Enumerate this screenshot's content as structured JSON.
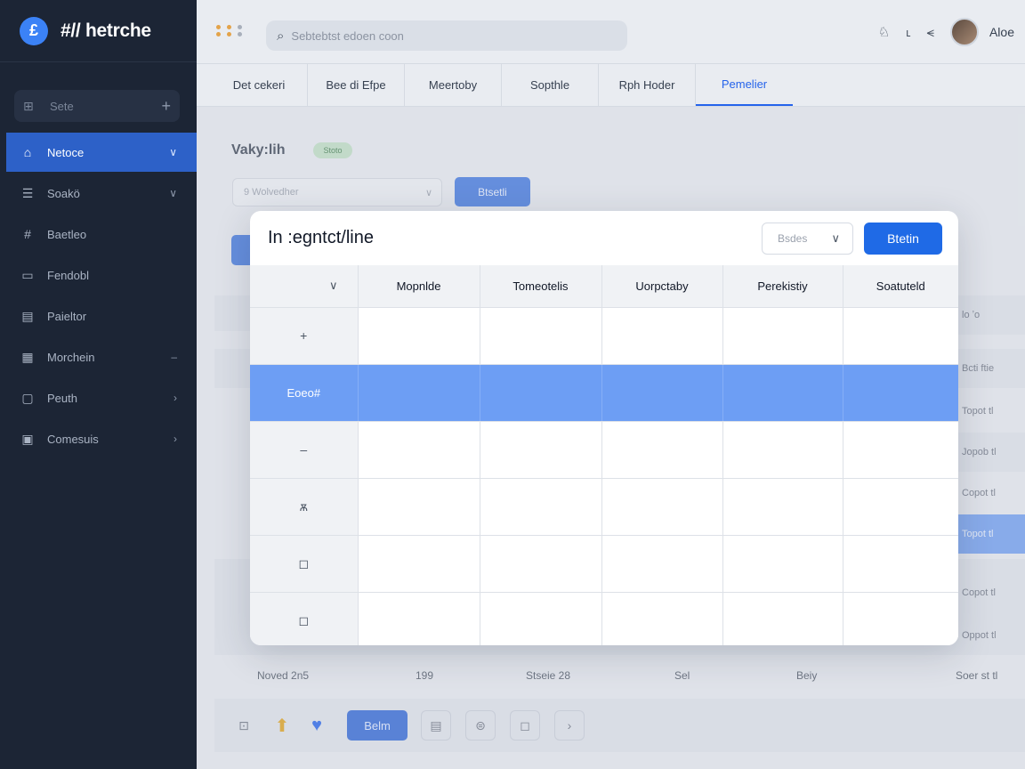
{
  "brand": {
    "logo_glyph": "£",
    "name": "#// hetrche"
  },
  "sidebar": {
    "search": {
      "label": "Sete"
    },
    "items": [
      {
        "label": "Netoce",
        "icon": "store-icon",
        "glyph": "⌂",
        "chevron": "∨",
        "active": true
      },
      {
        "label": "Soakö",
        "icon": "list-icon",
        "glyph": "☰",
        "chevron": "∨"
      },
      {
        "label": "Baetleo",
        "icon": "hashtag-icon",
        "glyph": "#",
        "chevron": ""
      },
      {
        "label": "Fendobl",
        "icon": "tablet-icon",
        "glyph": "▭",
        "chevron": ""
      },
      {
        "label": "Paieltor",
        "icon": "calendar-icon",
        "glyph": "▤",
        "chevron": ""
      },
      {
        "label": "Morchein",
        "icon": "grid-icon",
        "glyph": "▦",
        "chevron": "–"
      },
      {
        "label": "Peuth",
        "icon": "folder-icon",
        "glyph": "▢",
        "chevron": "›"
      },
      {
        "label": "Comesuis",
        "icon": "image-icon",
        "glyph": "▣",
        "chevron": "›"
      }
    ]
  },
  "topbar": {
    "search_text": "Sebtebtst edoen coon",
    "user_name": "Aloe"
  },
  "tabs": [
    {
      "label": "Det cekeri",
      "active": false
    },
    {
      "label": "Bee di Efpe",
      "active": false
    },
    {
      "label": "Meertoby",
      "active": false
    },
    {
      "label": "Sopthle",
      "active": false
    },
    {
      "label": "Rph Hoder",
      "active": false
    },
    {
      "label": "Pemelier",
      "active": true
    }
  ],
  "background": {
    "panel_title": "Vaky:lih",
    "badge": "Stoto",
    "select_text": "9 Wolvedher",
    "button_label": "Btsetli",
    "side_items": [
      {
        "label": "lo ʼo",
        "style": "band"
      },
      {
        "label": "Bcti ftie",
        "style": "plain"
      },
      {
        "label": "Topot tl",
        "style": "plain"
      },
      {
        "label": "Jopob tl",
        "style": "band"
      },
      {
        "label": "Copot tl",
        "style": "plain"
      },
      {
        "label": "Topot tl",
        "style": "hi"
      },
      {
        "label": "Copot tl",
        "style": "plain"
      },
      {
        "label": "Oppot tl",
        "style": "plain"
      }
    ],
    "footer": [
      "Noved 2n5",
      "199",
      "Stseie 28",
      "Sel",
      "Beiy",
      "Soer st tl"
    ],
    "bottom_button": "Belm"
  },
  "modal": {
    "title": "In :egntct/line",
    "select_text": "Bsdes",
    "button_label": "Btetin",
    "columns": [
      "Mopnlde",
      "Tomeotelis",
      "Uorpctaby",
      "Perekistiy",
      "Soatuteld"
    ],
    "corner_glyph": "∨",
    "rows": [
      {
        "label": "+",
        "selected": false
      },
      {
        "label": "Eoeo#",
        "selected": true
      },
      {
        "label": "–",
        "selected": false
      },
      {
        "label": "ѫ",
        "selected": false
      },
      {
        "label": "◻",
        "selected": false
      },
      {
        "label": "◻",
        "selected": false
      }
    ]
  },
  "colors": {
    "sidebar_bg": "#1c2535",
    "accent": "#1f6ae6",
    "selected_row": "#6d9ef4"
  }
}
